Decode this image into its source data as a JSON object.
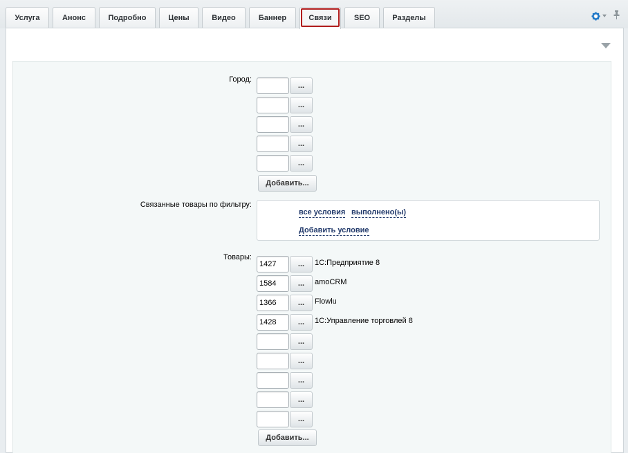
{
  "tabs": [
    {
      "label": "Услуга",
      "active": false
    },
    {
      "label": "Анонс",
      "active": false
    },
    {
      "label": "Подробно",
      "active": false
    },
    {
      "label": "Цены",
      "active": false
    },
    {
      "label": "Видео",
      "active": false
    },
    {
      "label": "Баннер",
      "active": false
    },
    {
      "label": "Связи",
      "active": true
    },
    {
      "label": "SEO",
      "active": false
    },
    {
      "label": "Разделы",
      "active": false
    }
  ],
  "toolbar": {
    "settings_icon": "gear-icon",
    "pin_icon": "pin-icon"
  },
  "colors": {
    "active_tab_outline": "#b01c1c",
    "link": "#223a6b",
    "background": "#e9edf0"
  },
  "city": {
    "label": "Город:",
    "inputs": [
      "",
      "",
      "",
      "",
      ""
    ],
    "browse_label": "...",
    "add_label": "Добавить..."
  },
  "filter": {
    "label": "Связанные товары по фильтру:",
    "all_conditions": "все условия",
    "fulfilled": "выполнено(ы)",
    "add_condition": "Добавить условие"
  },
  "products": {
    "label": "Товары:",
    "rows": [
      {
        "id": "1427",
        "name": "1С:Предприятие 8"
      },
      {
        "id": "1584",
        "name": "amoCRM"
      },
      {
        "id": "1366",
        "name": "Flowlu"
      },
      {
        "id": "1428",
        "name": "1С:Управление торговлей 8"
      },
      {
        "id": "",
        "name": ""
      },
      {
        "id": "",
        "name": ""
      },
      {
        "id": "",
        "name": ""
      },
      {
        "id": "",
        "name": ""
      },
      {
        "id": "",
        "name": ""
      }
    ],
    "browse_label": "...",
    "add_label": "Добавить..."
  }
}
